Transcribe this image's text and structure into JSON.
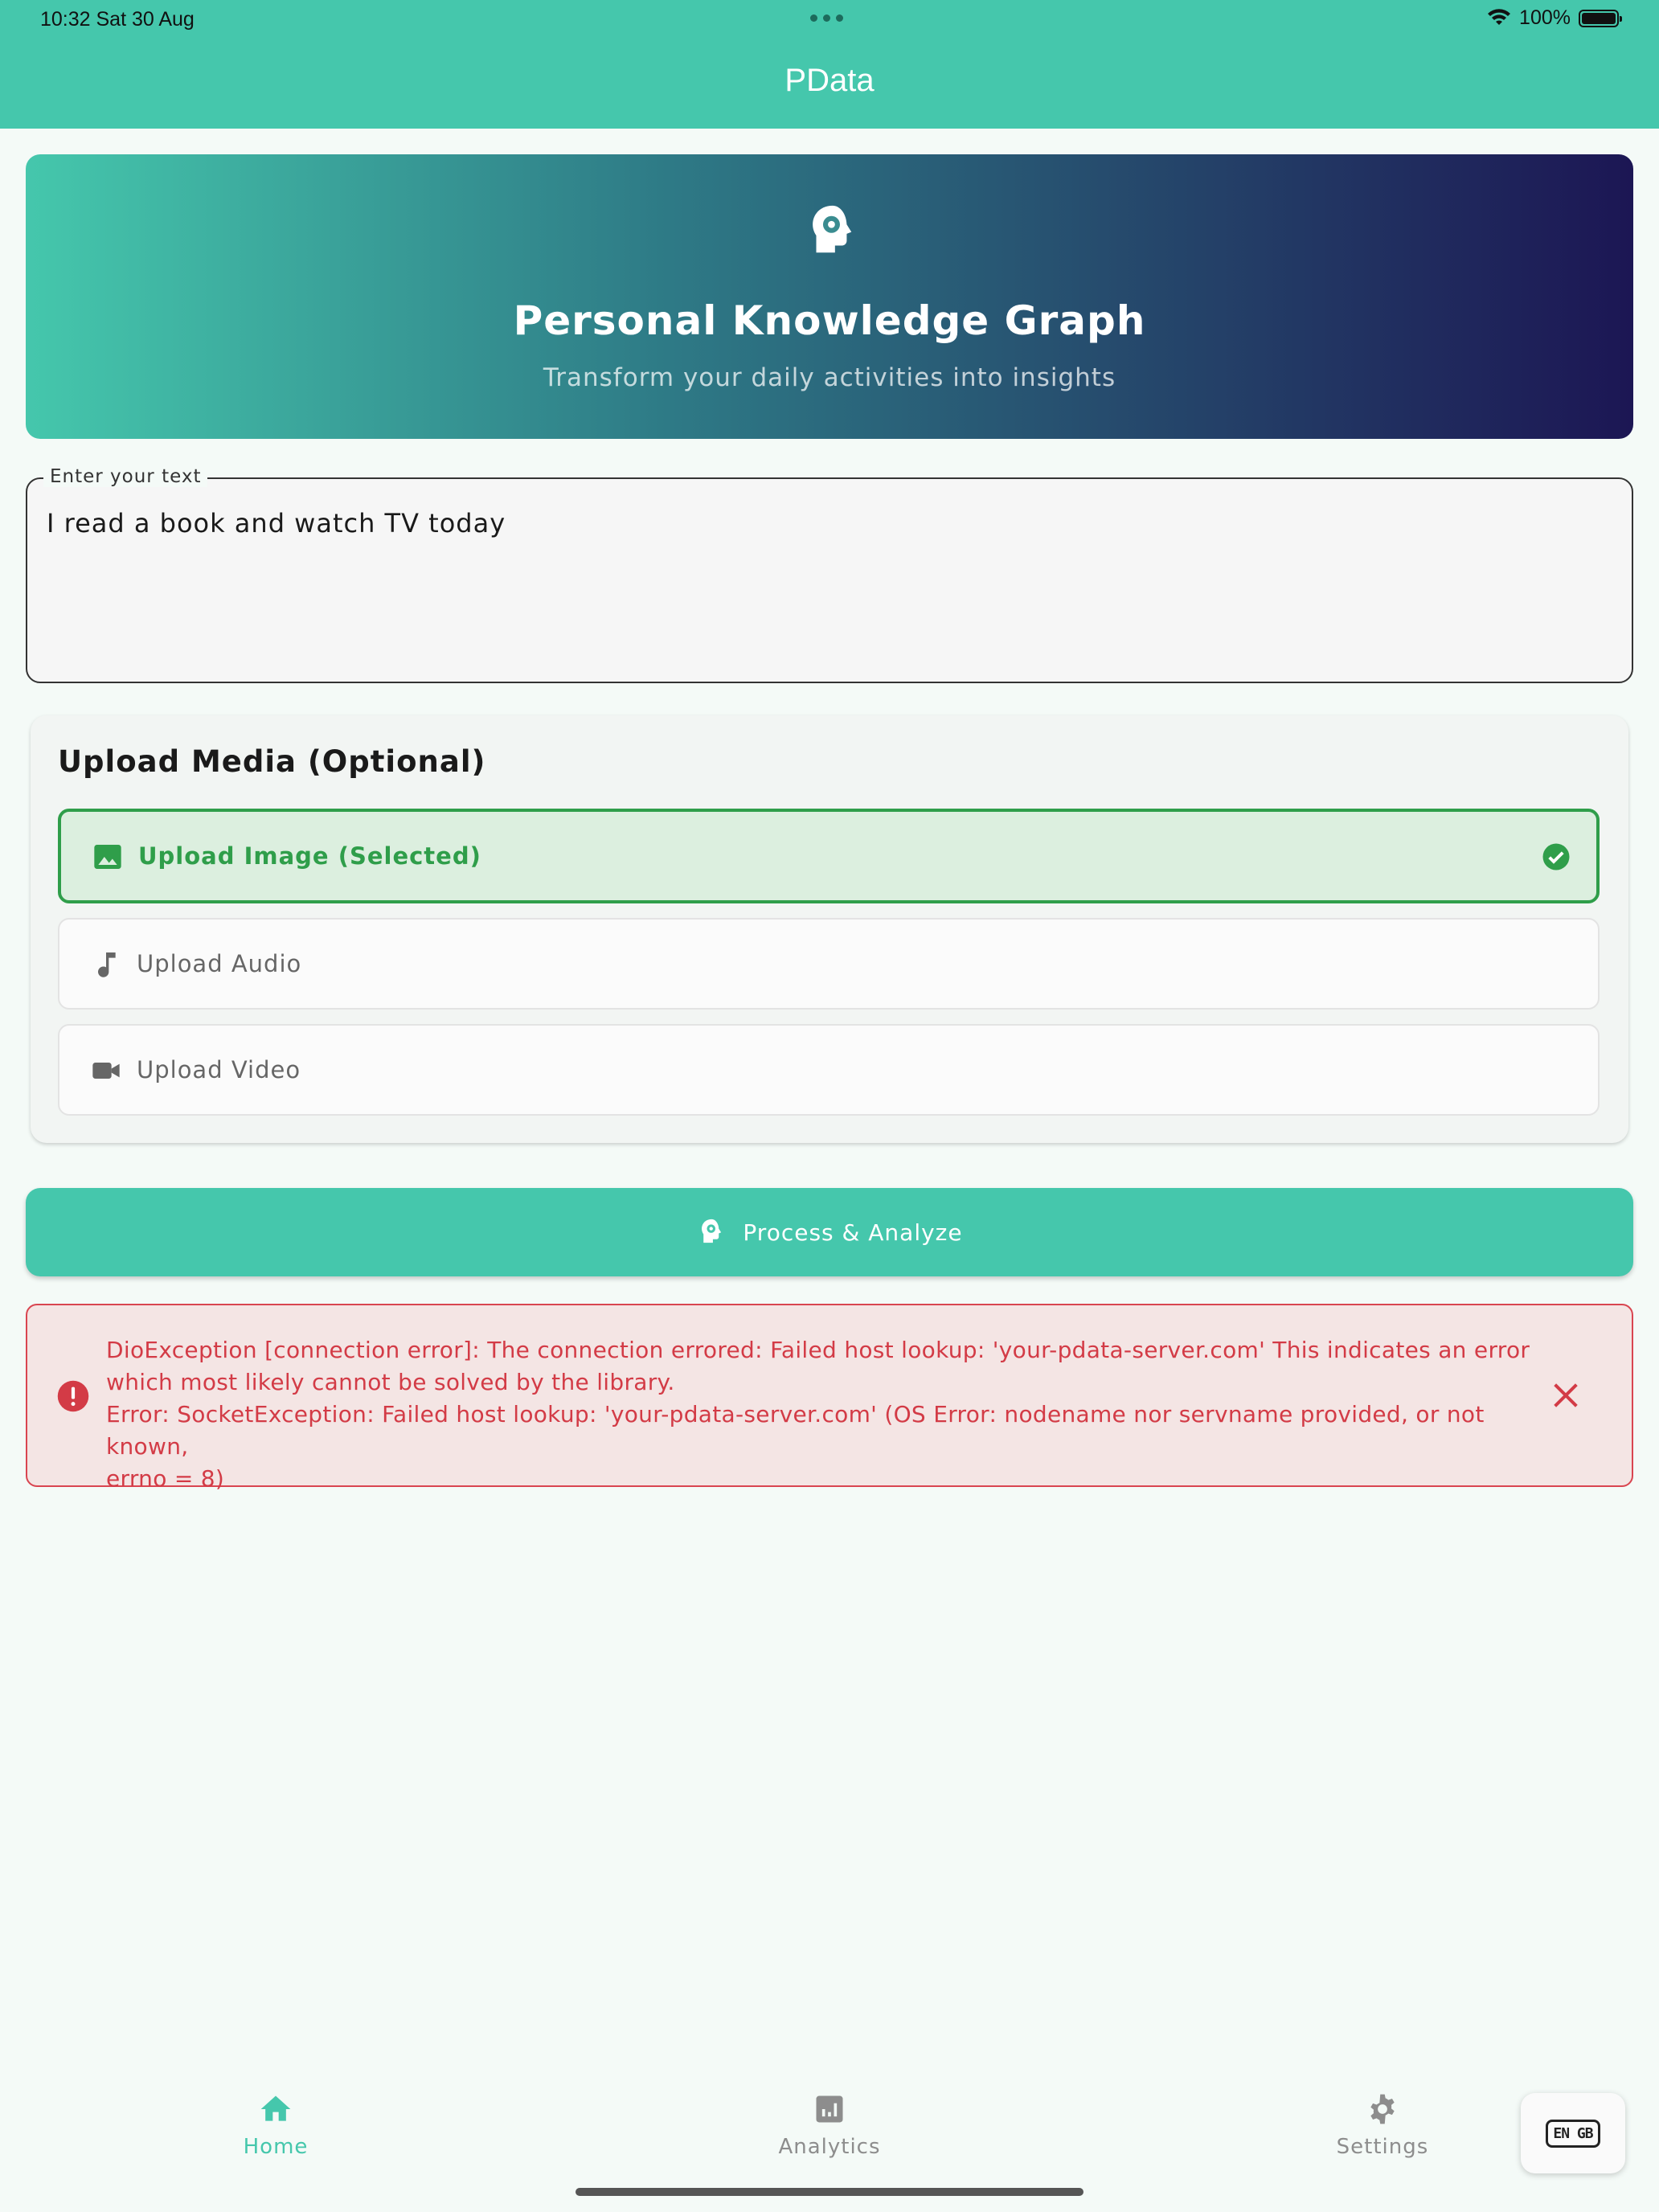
{
  "status_bar": {
    "time": "10:32   Sat 30 Aug",
    "battery": "100%"
  },
  "app_bar": {
    "title": "PData"
  },
  "hero": {
    "icon": "psychology-icon",
    "title": "Personal Knowledge Graph",
    "subtitle": "Transform your daily activities into insights"
  },
  "text_input": {
    "label": "Enter your text",
    "value": "I read a book and watch TV today"
  },
  "upload_media": {
    "title": "Upload Media (Optional)",
    "options": [
      {
        "label": "Upload Image (Selected)",
        "icon": "image-icon",
        "selected": true
      },
      {
        "label": "Upload Audio",
        "icon": "music-note-icon",
        "selected": false
      },
      {
        "label": "Upload Video",
        "icon": "videocam-icon",
        "selected": false
      }
    ]
  },
  "process_button": {
    "label": "Process & Analyze",
    "icon": "psychology-icon"
  },
  "error": {
    "line1": "DioException [connection error]: The connection errored: Failed host lookup: 'your-pdata-server.com' This indicates an error",
    "line2": "which most likely cannot be solved by the library.",
    "line3": "Error: SocketException: Failed host lookup: 'your-pdata-server.com' (OS Error: nodename nor servname provided, or not known,",
    "line4": "errno = 8)"
  },
  "bottom_nav": {
    "items": [
      {
        "label": "Home",
        "icon": "home-icon",
        "active": true
      },
      {
        "label": "Analytics",
        "icon": "analytics-icon",
        "active": false
      },
      {
        "label": "Settings",
        "icon": "settings-icon",
        "active": false
      }
    ],
    "language_badge": "EN GB"
  },
  "colors": {
    "primary": "#45c7ac",
    "hero_gradient_end": "#1c1654",
    "selected_green": "#2f9e4a",
    "error_red": "#d33b46"
  }
}
